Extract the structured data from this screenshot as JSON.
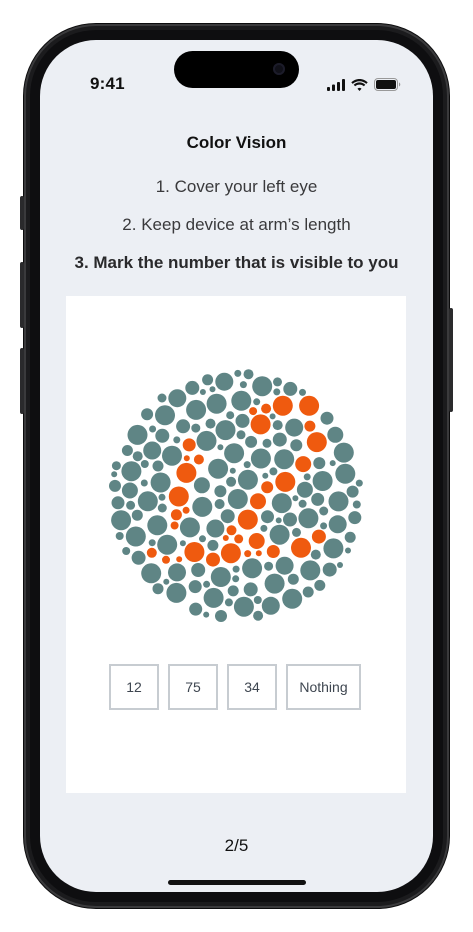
{
  "status_bar": {
    "time": "9:41",
    "icons": [
      "cellular-signal-icon",
      "wifi-icon",
      "battery-icon"
    ]
  },
  "screen": {
    "title": "Color Vision",
    "steps": [
      "1. Cover your left eye",
      "2. Keep device at arm’s length",
      "3. Mark the number that is visible to you"
    ]
  },
  "plate": {
    "background_color": "#5f8585",
    "figure_color": "#ef5a0f"
  },
  "options": [
    {
      "label": "12"
    },
    {
      "label": "75"
    },
    {
      "label": "34"
    },
    {
      "label": "Nothing"
    }
  ],
  "progress": "2/5",
  "colors": {
    "screen_bg": "#eceff4",
    "card_bg": "#ffffff",
    "option_border": "#c7ccd1"
  }
}
